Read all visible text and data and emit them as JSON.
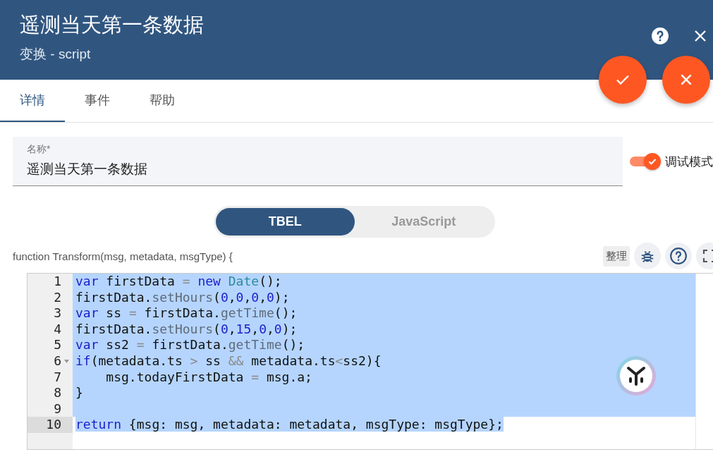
{
  "header": {
    "title": "遥测当天第一条数据",
    "subtitle": "变换 - script"
  },
  "tabs": [
    {
      "label": "详情",
      "selected": true
    },
    {
      "label": "事件",
      "selected": false
    },
    {
      "label": "帮助",
      "selected": false
    }
  ],
  "name_field": {
    "label": "名称*",
    "value": "遥测当天第一条数据"
  },
  "debug_toggle": {
    "label": "调试模式",
    "on": true
  },
  "language_switch": [
    {
      "label": "TBEL",
      "selected": true
    },
    {
      "label": "JavaScript",
      "selected": false
    }
  ],
  "function_signature": "function Transform(msg, metadata, msgType) {",
  "editor_toolbar": {
    "tidy_button": "整理"
  },
  "editor": {
    "lines": [
      {
        "number": "1",
        "active": false,
        "foldable": false,
        "selected": true,
        "tokens": [
          {
            "kind": "keyword",
            "text": "var"
          },
          {
            "kind": "plain",
            "text": " firstData "
          },
          {
            "kind": "operator",
            "text": "="
          },
          {
            "kind": "keyword",
            "text": " new"
          },
          {
            "kind": "builtin",
            "text": " Date"
          },
          {
            "kind": "plain",
            "text": "();"
          }
        ]
      },
      {
        "number": "2",
        "active": false,
        "foldable": false,
        "selected": true,
        "tokens": [
          {
            "kind": "plain",
            "text": "firstData."
          },
          {
            "kind": "method",
            "text": "setHours"
          },
          {
            "kind": "plain",
            "text": "("
          },
          {
            "kind": "number",
            "text": "0"
          },
          {
            "kind": "plain",
            "text": ","
          },
          {
            "kind": "number",
            "text": "0"
          },
          {
            "kind": "plain",
            "text": ","
          },
          {
            "kind": "number",
            "text": "0"
          },
          {
            "kind": "plain",
            "text": ","
          },
          {
            "kind": "number",
            "text": "0"
          },
          {
            "kind": "plain",
            "text": ");"
          }
        ]
      },
      {
        "number": "3",
        "active": false,
        "foldable": false,
        "selected": true,
        "tokens": [
          {
            "kind": "keyword",
            "text": "var"
          },
          {
            "kind": "plain",
            "text": " ss "
          },
          {
            "kind": "operator",
            "text": "="
          },
          {
            "kind": "plain",
            "text": " firstData."
          },
          {
            "kind": "method",
            "text": "getTime"
          },
          {
            "kind": "plain",
            "text": "();"
          }
        ]
      },
      {
        "number": "4",
        "active": false,
        "foldable": false,
        "selected": true,
        "tokens": [
          {
            "kind": "plain",
            "text": "firstData."
          },
          {
            "kind": "method",
            "text": "setHours"
          },
          {
            "kind": "plain",
            "text": "("
          },
          {
            "kind": "number",
            "text": "0"
          },
          {
            "kind": "plain",
            "text": ","
          },
          {
            "kind": "number",
            "text": "15"
          },
          {
            "kind": "plain",
            "text": ","
          },
          {
            "kind": "number",
            "text": "0"
          },
          {
            "kind": "plain",
            "text": ","
          },
          {
            "kind": "number",
            "text": "0"
          },
          {
            "kind": "plain",
            "text": ");"
          }
        ]
      },
      {
        "number": "5",
        "active": false,
        "foldable": false,
        "selected": true,
        "tokens": [
          {
            "kind": "keyword",
            "text": "var"
          },
          {
            "kind": "plain",
            "text": " ss2 "
          },
          {
            "kind": "operator",
            "text": "="
          },
          {
            "kind": "plain",
            "text": " firstData."
          },
          {
            "kind": "method",
            "text": "getTime"
          },
          {
            "kind": "plain",
            "text": "();"
          }
        ]
      },
      {
        "number": "6",
        "active": false,
        "foldable": true,
        "selected": true,
        "tokens": [
          {
            "kind": "keyword",
            "text": "if"
          },
          {
            "kind": "plain",
            "text": "(metadata.ts "
          },
          {
            "kind": "operator",
            "text": ">"
          },
          {
            "kind": "plain",
            "text": " ss "
          },
          {
            "kind": "operator",
            "text": "&&"
          },
          {
            "kind": "plain",
            "text": " metadata.ts"
          },
          {
            "kind": "operator",
            "text": "<"
          },
          {
            "kind": "plain",
            "text": "ss2){"
          }
        ]
      },
      {
        "number": "7",
        "active": false,
        "foldable": false,
        "selected": true,
        "tokens": [
          {
            "kind": "plain",
            "text": "    msg.todayFirstData "
          },
          {
            "kind": "operator",
            "text": "="
          },
          {
            "kind": "plain",
            "text": " msg.a;"
          }
        ]
      },
      {
        "number": "8",
        "active": false,
        "foldable": false,
        "selected": true,
        "tokens": [
          {
            "kind": "plain",
            "text": "}"
          }
        ]
      },
      {
        "number": "9",
        "active": false,
        "foldable": false,
        "selected": true
      },
      {
        "number": "10",
        "active": true,
        "foldable": false,
        "selected": true,
        "tokens": [
          {
            "kind": "keyword",
            "text": "return"
          },
          {
            "kind": "plain",
            "text": " {msg: msg, metadata: metadata, msgType: msgType};"
          }
        ]
      }
    ]
  }
}
